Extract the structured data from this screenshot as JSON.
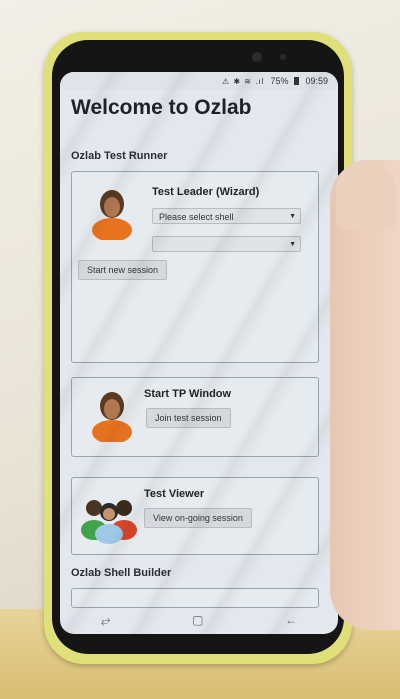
{
  "device": {
    "status": {
      "icons": "⚠ ✱ ≋ .ıl",
      "battery": "75%",
      "time": "09:59"
    },
    "navbar": {
      "recent_icon": "recent-apps-icon",
      "home_icon": "home-icon",
      "back_icon": "back-icon"
    }
  },
  "app": {
    "title": "Welcome to Ozlab",
    "runner_section": "Ozlab Test Runner",
    "leader": {
      "title": "Test Leader (Wizard)",
      "shell_select": "Please select shell",
      "second_select": "",
      "start_button": "Start new session"
    },
    "tp": {
      "title": "Start TP Window",
      "join_button": "Join test session"
    },
    "viewer": {
      "title": "Test Viewer",
      "view_button": "View on-going session"
    },
    "builder_section": "Ozlab Shell Builder"
  }
}
